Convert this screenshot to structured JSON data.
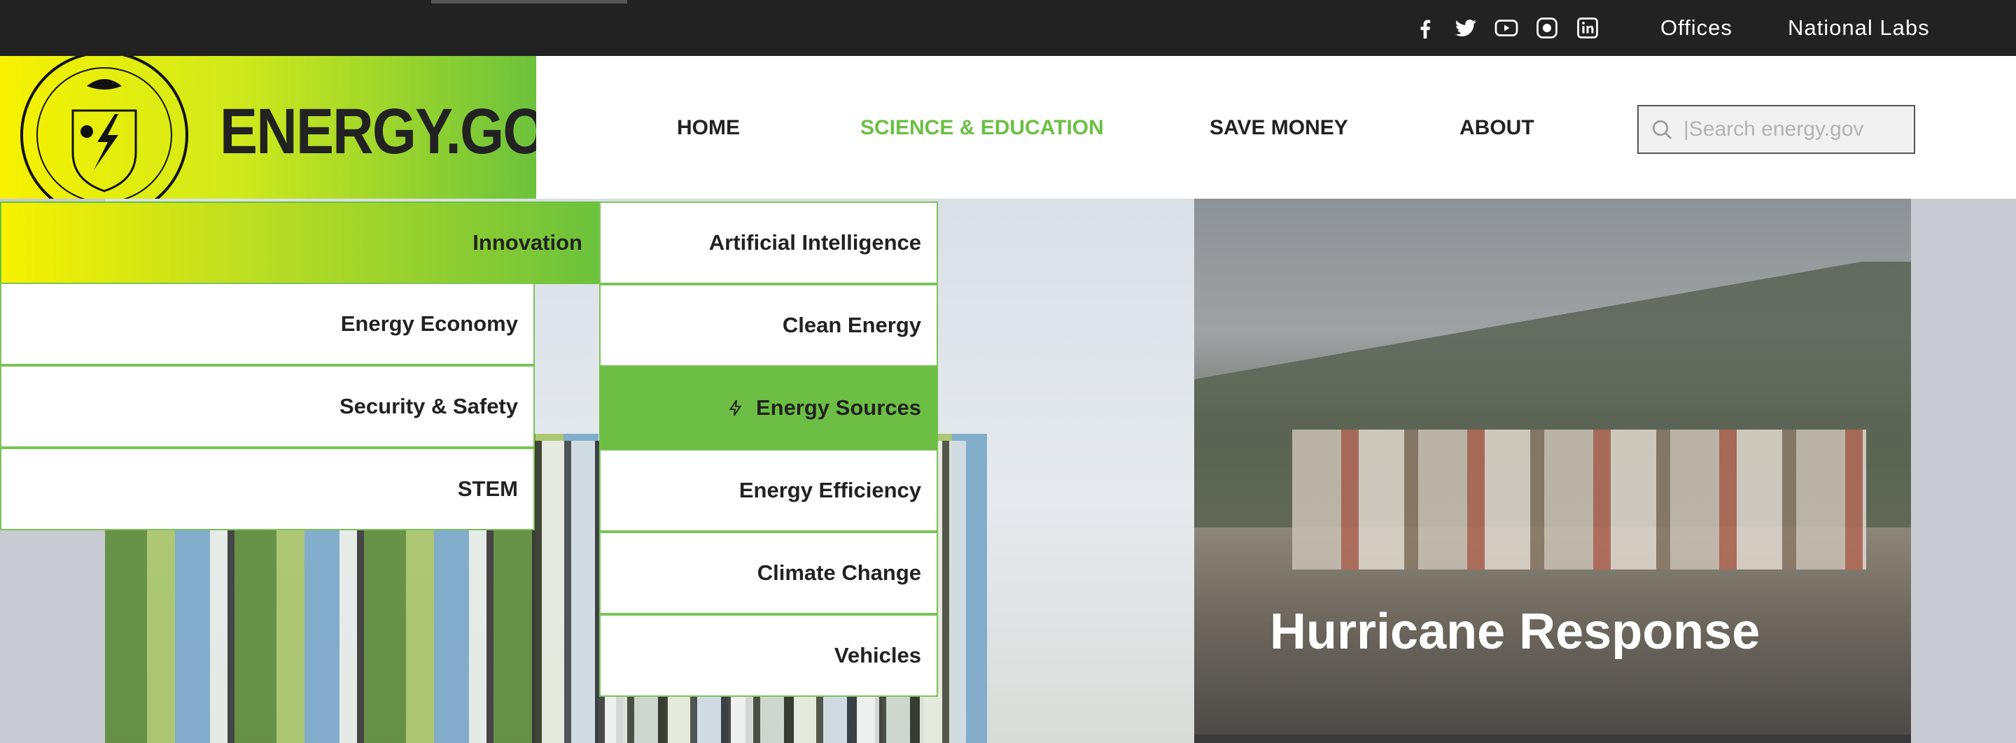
{
  "topbar": {
    "social": [
      "facebook-icon",
      "twitter-icon",
      "youtube-icon",
      "instagram-icon",
      "linkedin-icon"
    ],
    "offices": "Offices",
    "national_labs": "National Labs"
  },
  "header": {
    "brand": "ENERGY.GOV",
    "nav": {
      "home": "HOME",
      "science": "SCIENCE & EDUCATION",
      "money": "SAVE MONEY",
      "about": "ABOUT"
    },
    "search": {
      "placeholder": "|Search energy.gov"
    }
  },
  "menu": {
    "primary": [
      "Innovation",
      "Energy Economy",
      "Security & Safety",
      "STEM"
    ],
    "secondary": [
      "Artificial Intelligence",
      "Clean Energy",
      "Energy Sources",
      "Energy Efficiency",
      "Climate Change",
      "Vehicles"
    ]
  },
  "hero": {
    "feature_title": "Hurricane Response"
  },
  "colors": {
    "brand_green": "#6cbf44",
    "brand_yellow": "#f7f200",
    "topbar": "#222222"
  }
}
